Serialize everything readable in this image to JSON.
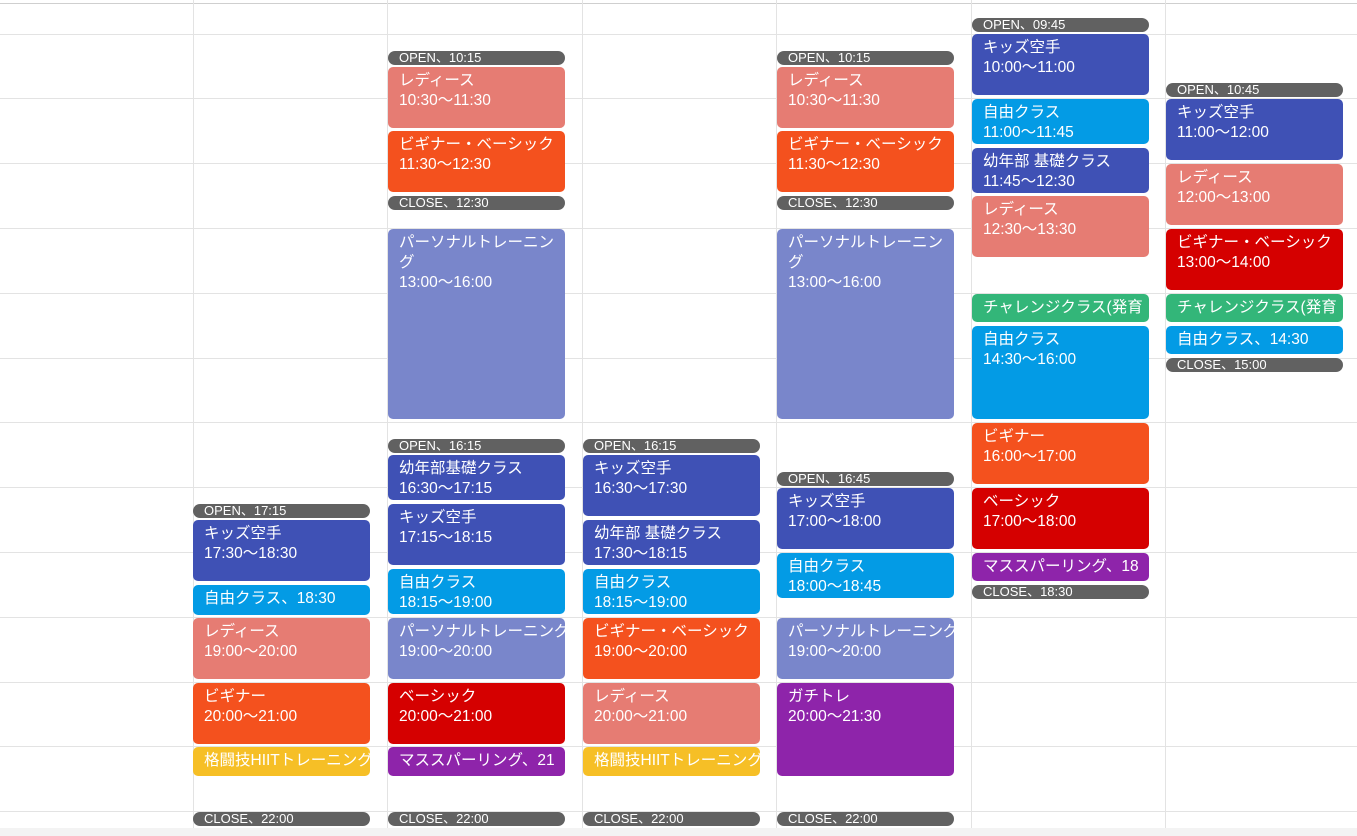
{
  "colors": {
    "indigo": "#3f51b5",
    "salmon": "#e67c73",
    "tangerine": "#f4511e",
    "lavender": "#7986cb",
    "peacock": "#039be5",
    "tomato": "#d50000",
    "grape": "#8e24aa",
    "banana": "#f6bf26",
    "sage": "#33b679",
    "marker": "#616161"
  },
  "columns": {
    "col1": {
      "events": [
        {
          "kind": "marker",
          "label": "OPEN、17:15"
        },
        {
          "kind": "event",
          "title": "キッズ空手",
          "time": "17:30〜18:30",
          "color": "#3f51b5"
        },
        {
          "kind": "event",
          "title": "自由クラス、18:30",
          "color": "#039be5"
        },
        {
          "kind": "event",
          "title": "レディース",
          "time": "19:00〜20:00",
          "color": "#e67c73"
        },
        {
          "kind": "event",
          "title": "ビギナー",
          "time": "20:00〜21:00",
          "color": "#f4511e"
        },
        {
          "kind": "event",
          "title": "格闘技HIITトレーニング",
          "color": "#f6bf26"
        },
        {
          "kind": "marker",
          "label": "CLOSE、22:00"
        }
      ]
    },
    "col2": {
      "events": [
        {
          "kind": "marker",
          "label": "OPEN、10:15"
        },
        {
          "kind": "event",
          "title": "レディース",
          "time": "10:30〜11:30",
          "color": "#e67c73"
        },
        {
          "kind": "event",
          "title": "ビギナー・ベーシック",
          "time": "11:30〜12:30",
          "color": "#f4511e"
        },
        {
          "kind": "marker",
          "label": "CLOSE、12:30"
        },
        {
          "kind": "event",
          "title": "パーソナルトレーニング",
          "time": "13:00〜16:00",
          "color": "#7986cb"
        },
        {
          "kind": "marker",
          "label": "OPEN、16:15"
        },
        {
          "kind": "event",
          "title": "幼年部基礎クラス",
          "time": "16:30〜17:15",
          "color": "#3f51b5"
        },
        {
          "kind": "event",
          "title": "キッズ空手",
          "time": "17:15〜18:15",
          "color": "#3f51b5"
        },
        {
          "kind": "event",
          "title": "自由クラス",
          "time": "18:15〜19:00",
          "color": "#039be5"
        },
        {
          "kind": "event",
          "title": "パーソナルトレーニング",
          "time": "19:00〜20:00",
          "color": "#7986cb"
        },
        {
          "kind": "event",
          "title": "ベーシック",
          "time": "20:00〜21:00",
          "color": "#d50000"
        },
        {
          "kind": "event",
          "title": "マススパーリング、21",
          "color": "#8e24aa"
        },
        {
          "kind": "marker",
          "label": "CLOSE、22:00"
        }
      ]
    },
    "col3": {
      "events": [
        {
          "kind": "marker",
          "label": "OPEN、16:15"
        },
        {
          "kind": "event",
          "title": "キッズ空手",
          "time": "16:30〜17:30",
          "color": "#3f51b5"
        },
        {
          "kind": "event",
          "title": "幼年部 基礎クラス",
          "time": "17:30〜18:15",
          "color": "#3f51b5"
        },
        {
          "kind": "event",
          "title": "自由クラス",
          "time": "18:15〜19:00",
          "color": "#039be5"
        },
        {
          "kind": "event",
          "title": "ビギナー・ベーシック",
          "time": "19:00〜20:00",
          "color": "#f4511e"
        },
        {
          "kind": "event",
          "title": "レディース",
          "time": "20:00〜21:00",
          "color": "#e67c73"
        },
        {
          "kind": "event",
          "title": "格闘技HIITトレーニング",
          "color": "#f6bf26"
        },
        {
          "kind": "marker",
          "label": "CLOSE、22:00"
        }
      ]
    },
    "col4": {
      "events": [
        {
          "kind": "marker",
          "label": "OPEN、10:15"
        },
        {
          "kind": "event",
          "title": "レディース",
          "time": "10:30〜11:30",
          "color": "#e67c73"
        },
        {
          "kind": "event",
          "title": "ビギナー・ベーシック",
          "time": "11:30〜12:30",
          "color": "#f4511e"
        },
        {
          "kind": "marker",
          "label": "CLOSE、12:30"
        },
        {
          "kind": "event",
          "title": "パーソナルトレーニング",
          "time": "13:00〜16:00",
          "color": "#7986cb"
        },
        {
          "kind": "marker",
          "label": "OPEN、16:45"
        },
        {
          "kind": "event",
          "title": "キッズ空手",
          "time": "17:00〜18:00",
          "color": "#3f51b5"
        },
        {
          "kind": "event",
          "title": "自由クラス",
          "time": "18:00〜18:45",
          "color": "#039be5"
        },
        {
          "kind": "event",
          "title": "パーソナルトレーニング",
          "time": "19:00〜20:00",
          "color": "#7986cb"
        },
        {
          "kind": "event",
          "title": "ガチトレ",
          "time": "20:00〜21:30",
          "color": "#8e24aa"
        },
        {
          "kind": "marker",
          "label": "CLOSE、22:00"
        }
      ]
    },
    "col5": {
      "events": [
        {
          "kind": "marker",
          "label": "OPEN、09:45"
        },
        {
          "kind": "event",
          "title": "キッズ空手",
          "time": "10:00〜11:00",
          "color": "#3f51b5"
        },
        {
          "kind": "event",
          "title": "自由クラス",
          "time": "11:00〜11:45",
          "color": "#039be5"
        },
        {
          "kind": "event",
          "title": "幼年部 基礎クラス",
          "time": "11:45〜12:30",
          "color": "#3f51b5"
        },
        {
          "kind": "event",
          "title": "レディース",
          "time": "12:30〜13:30",
          "color": "#e67c73"
        },
        {
          "kind": "event",
          "title": "チャレンジクラス(発育",
          "color": "#33b679"
        },
        {
          "kind": "event",
          "title": "自由クラス",
          "time": "14:30〜16:00",
          "color": "#039be5"
        },
        {
          "kind": "event",
          "title": "ビギナー",
          "time": "16:00〜17:00",
          "color": "#f4511e"
        },
        {
          "kind": "event",
          "title": "ベーシック",
          "time": "17:00〜18:00",
          "color": "#d50000"
        },
        {
          "kind": "event",
          "title": "マススパーリング、18",
          "color": "#8e24aa"
        },
        {
          "kind": "marker",
          "label": "CLOSE、18:30"
        }
      ]
    },
    "col6": {
      "events": [
        {
          "kind": "marker",
          "label": "OPEN、10:45"
        },
        {
          "kind": "event",
          "title": "キッズ空手",
          "time": "11:00〜12:00",
          "color": "#3f51b5"
        },
        {
          "kind": "event",
          "title": "レディース",
          "time": "12:00〜13:00",
          "color": "#e67c73"
        },
        {
          "kind": "event",
          "title": "ビギナー・ベーシック",
          "time": "13:00〜14:00",
          "color": "#d50000"
        },
        {
          "kind": "event",
          "title": "チャレンジクラス(発育",
          "color": "#33b679"
        },
        {
          "kind": "event",
          "title": "自由クラス、14:30",
          "color": "#039be5"
        },
        {
          "kind": "marker",
          "label": "CLOSE、15:00"
        }
      ]
    }
  }
}
